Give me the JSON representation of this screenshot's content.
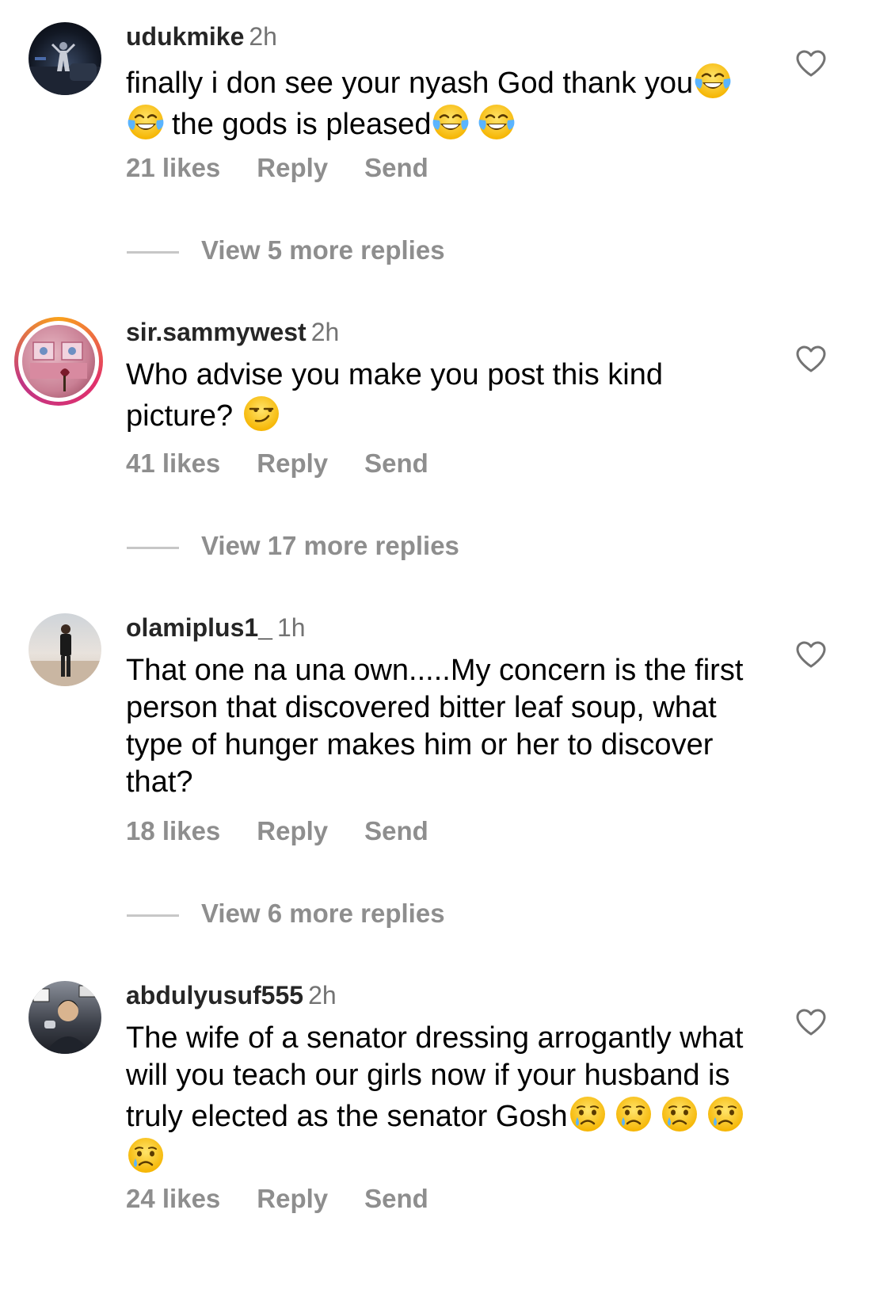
{
  "comments": [
    {
      "username": "udukmike",
      "time": "2h",
      "text_parts": [
        "finally i don see your nyash God thank you",
        "",
        "the gods is pleased",
        "",
        ""
      ],
      "likes": "21 likes",
      "reply": "Reply",
      "send": "Send",
      "view_replies": "View 5 more replies",
      "emoji": "face-with-tears-of-joy"
    },
    {
      "username": "sir.sammywest",
      "time": "2h",
      "text_parts": [
        "Who advise you make you post this kind picture? ",
        ""
      ],
      "likes": "41 likes",
      "reply": "Reply",
      "send": "Send",
      "view_replies": "View 17 more replies",
      "emoji": "smirking-face",
      "has_story_ring": true
    },
    {
      "username": "olamiplus1_",
      "time": "1h",
      "text": "That one na una own.....My concern is the first person that discovered bitter leaf soup, what type of hunger makes him or her to discover that?",
      "likes": "18 likes",
      "reply": "Reply",
      "send": "Send",
      "view_replies": "View 6 more replies"
    },
    {
      "username": "abdulyusuf555",
      "time": "2h",
      "text": "The wife of a senator dressing arrogantly what will you teach our girls now if your husband is truly elected as the senator Gosh",
      "likes": "24 likes",
      "reply": "Reply",
      "send": "Send",
      "emoji": "crying-face"
    }
  ],
  "colors": {
    "username": "#262626",
    "secondary": "#8e8e8e",
    "timestamp": "#737373",
    "divider": "#c7c7c7"
  }
}
